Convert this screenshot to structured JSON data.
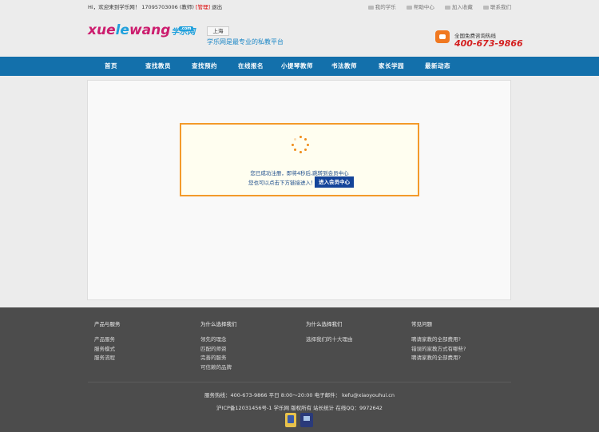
{
  "topbar": {
    "greeting": "Hi，欢迎来到学乐网！",
    "user_phone": "17095703006",
    "user_role": "(教师)",
    "admin_label": "[管理]",
    "logout": "退出",
    "links": {
      "my_xuele": "我的学乐",
      "help": "帮助中心",
      "favorite": "加入收藏",
      "contact": "联系我们"
    }
  },
  "header": {
    "logo": {
      "part1": "xue",
      "part2": "le",
      "part3": "wang",
      "cn": "学乐网",
      "com": ".com"
    },
    "city": "上海",
    "slogan": "学乐网是最专业的私教平台",
    "hotline_title": "全国免费咨询热线",
    "hotline_number": "400-673-9866",
    "phone_icon": "phone-icon"
  },
  "nav": {
    "items": [
      "首页",
      "查找教员",
      "查找预约",
      "在线报名",
      "小提琴教师",
      "书法教师",
      "家长学园",
      "最新动态"
    ]
  },
  "notice": {
    "line1": "您已成功注册，即将4秒后,跳转到会员中心",
    "line2": "您也可以点击下方链接进入！",
    "button": "进入会员中心",
    "spinner_icon": "loading-spinner-icon"
  },
  "footer": {
    "columns": [
      {
        "title": "产品与服务",
        "links": [
          "产品服务",
          "服务模式",
          "服务流程"
        ]
      },
      {
        "title": "为什么选择我们",
        "links": [
          "领先的理念",
          "匹配的师资",
          "完善的服务",
          "可信赖的品牌"
        ]
      },
      {
        "title": "为什么选择我们",
        "links": [
          "选择我们的十大理由"
        ]
      },
      {
        "title": "常见问题",
        "links": [
          "聘请家教的全部费用?",
          "错误的家教方式有哪些?",
          "聘请家教的全部费用?"
        ]
      }
    ],
    "service_line": "服务热线：400-673-9866    平日 8:00～20:00 电子邮件：   kefu@xiaoyouhui.cn",
    "icp_line": "沪ICP备12031456号-1    学乐网    版权所有    站长统计    在线QQ：9972642"
  },
  "colors": {
    "nav_bg": "#1370ab",
    "notice_border": "#f39a2a",
    "button_bg": "#14449a",
    "footer_bg": "#4c4c4c",
    "hotline": "#d42020"
  }
}
